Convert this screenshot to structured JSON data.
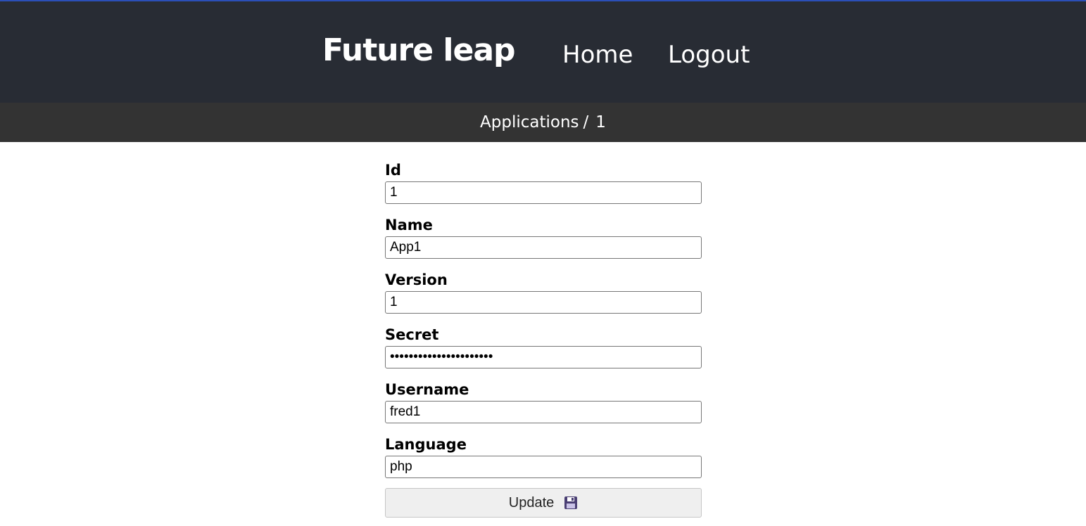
{
  "header": {
    "brand": "Future leap",
    "nav": {
      "home": "Home",
      "logout": "Logout"
    }
  },
  "breadcrumb": {
    "section": "Applications",
    "separator": "/",
    "current": "1"
  },
  "form": {
    "fields": [
      {
        "label": "Id",
        "value": "1",
        "type": "text"
      },
      {
        "label": "Name",
        "value": "App1",
        "type": "text"
      },
      {
        "label": "Version",
        "value": "1",
        "type": "text"
      },
      {
        "label": "Secret",
        "value": "••••••••••••••••••••••",
        "type": "password"
      },
      {
        "label": "Username",
        "value": "fred1",
        "type": "text"
      },
      {
        "label": "Language",
        "value": "php",
        "type": "text"
      }
    ],
    "submit_label": "Update",
    "submit_icon": "floppy-disk-icon"
  },
  "colors": {
    "header_bg": "#282c34",
    "breadcrumb_bg": "#333333",
    "accent_line": "#2b4fb8"
  }
}
